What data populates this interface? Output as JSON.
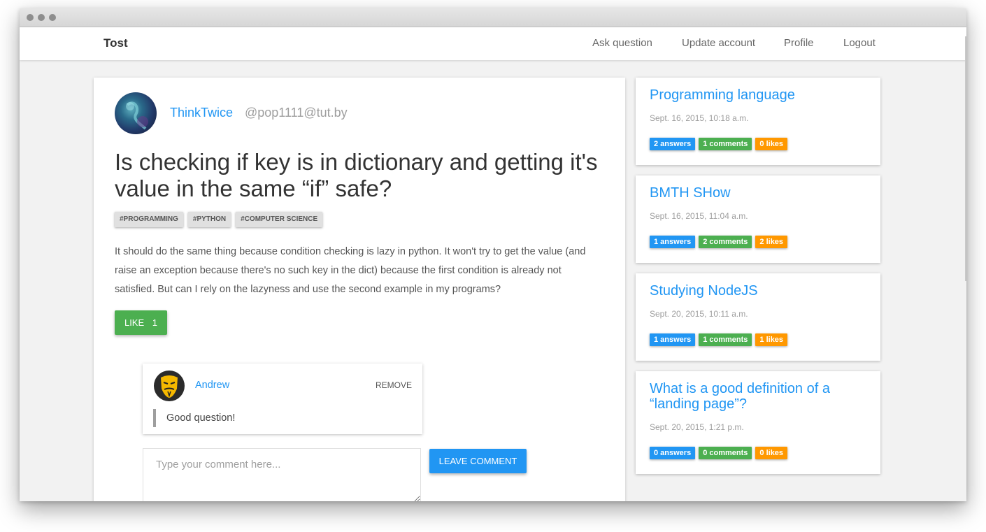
{
  "window": {
    "controls": [
      "close",
      "minimize",
      "maximize"
    ]
  },
  "navbar": {
    "brand": "Tost",
    "links": [
      "Ask question",
      "Update account",
      "Profile",
      "Logout"
    ]
  },
  "question": {
    "author_name": "ThinkTwice",
    "author_email": "@pop1111@tut.by",
    "title": "Is checking if key is in dictionary and getting it's value in the same “if” safe?",
    "tags": [
      "#programming",
      "#python",
      "#computer science"
    ],
    "body": "It should do the same thing because condition checking is lazy in python. It won't try to get the value (and raise an exception because there's no such key in the dict) because the first condition is already not satisfied. But can I rely on the lazyness and use the second example in my programs?",
    "like_label": "LIKE",
    "like_count": "1"
  },
  "comments": [
    {
      "author": "Andrew",
      "remove_label": "REMOVE",
      "text": "Good question!"
    }
  ],
  "comment_form": {
    "placeholder": "Type your comment here...",
    "submit_label": "LEAVE COMMENT"
  },
  "sidebar": {
    "questions": [
      {
        "title": "Programming language",
        "date": "Sept. 16, 2015, 10:18 a.m.",
        "answers": "2 answers",
        "comments": "1 comments",
        "likes": "0 likes"
      },
      {
        "title": "BMTH SHow",
        "date": "Sept. 16, 2015, 11:04 a.m.",
        "answers": "1 answers",
        "comments": "2 comments",
        "likes": "2 likes"
      },
      {
        "title": "Studying NodeJS",
        "date": "Sept. 20, 2015, 10:11 a.m.",
        "answers": "1 answers",
        "comments": "1 comments",
        "likes": "1 likes"
      },
      {
        "title": "What is a good definition of a “landing page”?",
        "date": "Sept. 20, 2015, 1:21 p.m.",
        "answers": "0 answers",
        "comments": "0 comments",
        "likes": "0 likes"
      }
    ]
  },
  "colors": {
    "accent": "#2196f3",
    "success": "#4caf50",
    "warning": "#ff9800"
  }
}
